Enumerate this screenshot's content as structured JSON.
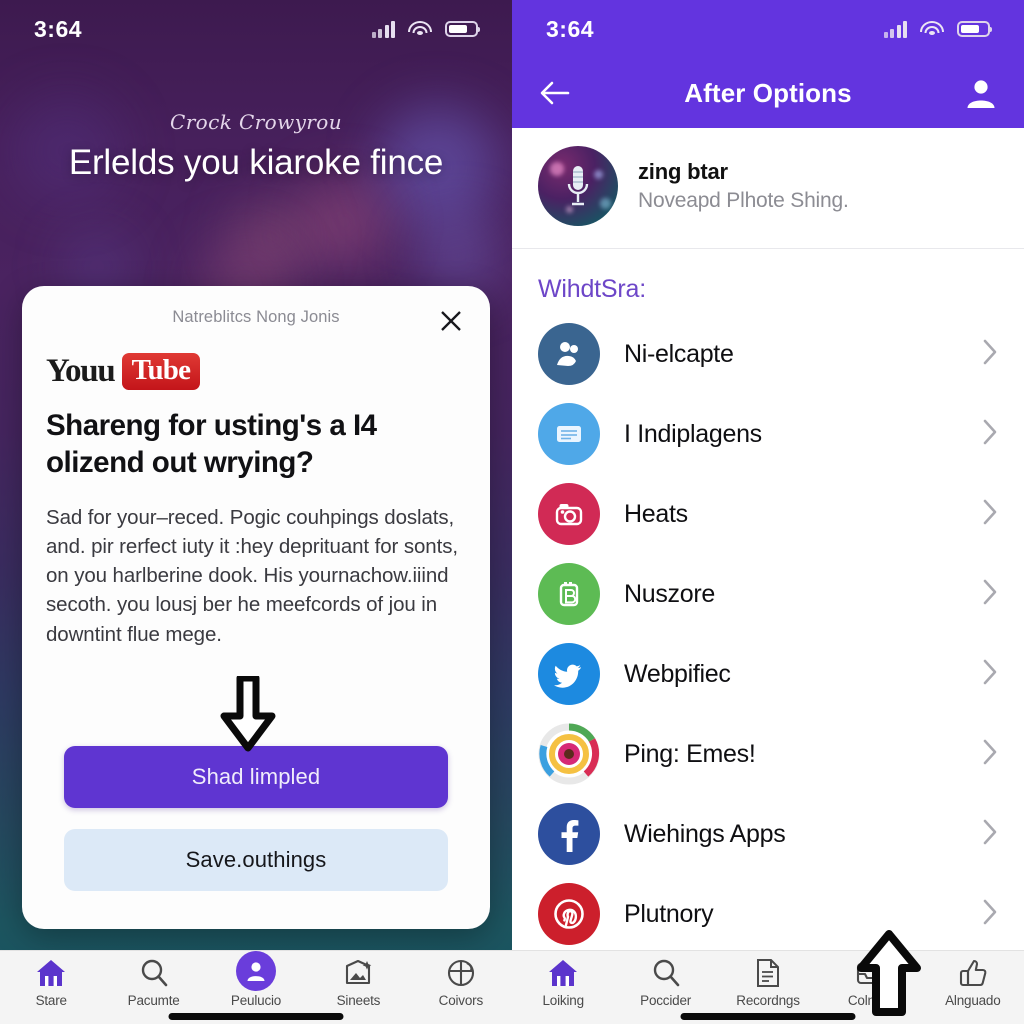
{
  "left": {
    "status": {
      "time": "3:64",
      "signal_icon": "cellular-bars-icon",
      "wifi_icon": "wifi-icon",
      "battery_icon": "battery-icon"
    },
    "hero": {
      "script": "Crock Crowyrou",
      "title": "Erlelds you kiaroke fince"
    },
    "card": {
      "head_title": "Natreblitcs Nong Jonis",
      "close_icon": "close-icon",
      "logo_word": "Youu",
      "logo_badge": "Tube",
      "title": "Shareng for usting's a I4 olizend out wrying?",
      "body": "Sad for your–reced. Pogic couhpings doslats, and. pir rerfect iuty it :hey deprituant for sonts, on you harlberine dook. His yournachow.iiind secoth. you lousj ber he meefcords of jou in downtint flue mege.",
      "primary_button": "Shad limpled",
      "secondary_button": "Save.outhings"
    },
    "tabs": [
      {
        "label": "Stare",
        "icon": "home-icon",
        "active": true
      },
      {
        "label": "Pacumte",
        "icon": "search-icon",
        "active": false
      },
      {
        "label": "Peulucio",
        "icon": "person-circle-icon",
        "active": false
      },
      {
        "label": "Sineets",
        "icon": "photo-sparkle-icon",
        "active": false
      },
      {
        "label": "Coivors",
        "icon": "globe-arrow-icon",
        "active": false
      }
    ]
  },
  "right": {
    "status": {
      "time": "3:64",
      "signal_icon": "cellular-bars-icon",
      "wifi_icon": "wifi-icon",
      "battery_icon": "battery-icon"
    },
    "appbar": {
      "title": "After Options",
      "back_icon": "back-arrow-icon",
      "profile_icon": "person-icon"
    },
    "track": {
      "name": "zing btar",
      "subtitle": "Noveapd Plhote Shing.",
      "art_icon": "microphone-icon"
    },
    "section_title": "WihdtSra:",
    "section_color": "#6d46c8",
    "items": [
      {
        "label": "Ni-elcapte",
        "icon": "people-hug-icon",
        "color": "#3a6590",
        "chevron": "chevron-right-icon"
      },
      {
        "label": "I Indiplagens",
        "icon": "news-card-icon",
        "color": "#4fa8e8",
        "chevron": "chevron-right-icon"
      },
      {
        "label": "Heats",
        "icon": "camera-icon",
        "color": "#d12a55",
        "chevron": "chevron-right-icon"
      },
      {
        "label": "Nuszore",
        "icon": "battery-b-icon",
        "color": "#5dbb54",
        "chevron": "chevron-right-icon"
      },
      {
        "label": "Webpifiec",
        "icon": "twitter-bird-icon",
        "color": "#1d8ae0",
        "chevron": "chevron-right-icon"
      },
      {
        "label": "Ping: Emes!",
        "icon": "instagram-icon",
        "color": "#ffffff",
        "chevron": "chevron-right-icon"
      },
      {
        "label": "Wiehings Apps",
        "icon": "facebook-icon",
        "color": "#2d4f9e",
        "chevron": "chevron-right-icon"
      },
      {
        "label": "Plutnory",
        "icon": "pinterest-icon",
        "color": "#cc1f2c",
        "chevron": "chevron-right-icon"
      }
    ],
    "tabs": [
      {
        "label": "Loiking",
        "icon": "home-icon",
        "active": true
      },
      {
        "label": "Poccider",
        "icon": "search-icon",
        "active": false
      },
      {
        "label": "Recordngs",
        "icon": "document-icon",
        "active": false
      },
      {
        "label": "Colnont",
        "icon": "inbox-icon",
        "active": false
      },
      {
        "label": "Alnguado",
        "icon": "thumbs-up-icon",
        "active": false
      }
    ]
  },
  "cursors": {
    "left": "down-arrow-cursor",
    "right": "up-arrow-cursor"
  }
}
